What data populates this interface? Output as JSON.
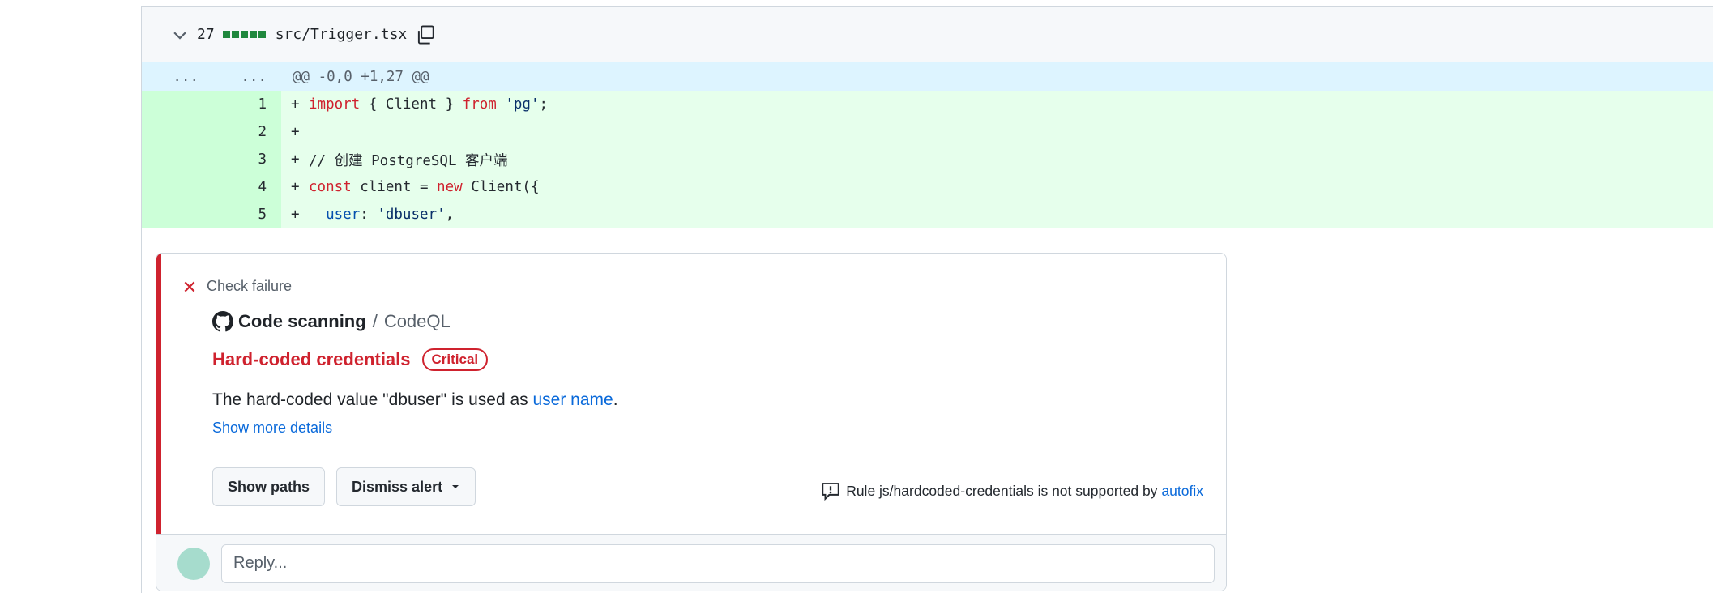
{
  "file": {
    "changes_count": "27",
    "filename": "src/Trigger.tsx"
  },
  "hunk": {
    "left_marker": "...",
    "right_marker": "...",
    "header": "@@ -0,0 +1,27 @@"
  },
  "lines": [
    {
      "num": "1",
      "sign": "+"
    },
    {
      "num": "2",
      "sign": "+"
    },
    {
      "num": "3",
      "sign": "+"
    },
    {
      "num": "4",
      "sign": "+"
    },
    {
      "num": "5",
      "sign": "+"
    }
  ],
  "code": {
    "l1_kw1": "import",
    "l1_mid": " { Client } ",
    "l1_kw2": "from",
    "l1_sp": " ",
    "l1_str": "'pg'",
    "l1_end": ";",
    "l3_comment": "// 创建 PostgreSQL 客户端",
    "l4_kw1": "const",
    "l4_mid": " client = ",
    "l4_kw2": "new",
    "l4_end": " Client({",
    "l5_indent": "  ",
    "l5_prop": "user",
    "l5_colon": ": ",
    "l5_str": "'dbuser'",
    "l5_end": ","
  },
  "alert": {
    "status": "Check failure",
    "tool_name": "Code scanning",
    "separator": "/",
    "tool_sub": "CodeQL",
    "rule_title": "Hard-coded credentials",
    "severity": "Critical",
    "desc_prefix": "The hard-coded value \"dbuser\" is used as ",
    "desc_link": "user name",
    "desc_suffix": ".",
    "show_more": "Show more details",
    "btn_show_paths": "Show paths",
    "btn_dismiss": "Dismiss alert",
    "notice_text": "Rule js/hardcoded-credentials is not supported by",
    "notice_link": "autofix"
  },
  "reply": {
    "placeholder": "Reply..."
  },
  "colors": {
    "add_bg": "#e6ffec",
    "hunk_bg": "#ddf4ff",
    "danger": "#cf222e",
    "link": "#0969da"
  }
}
